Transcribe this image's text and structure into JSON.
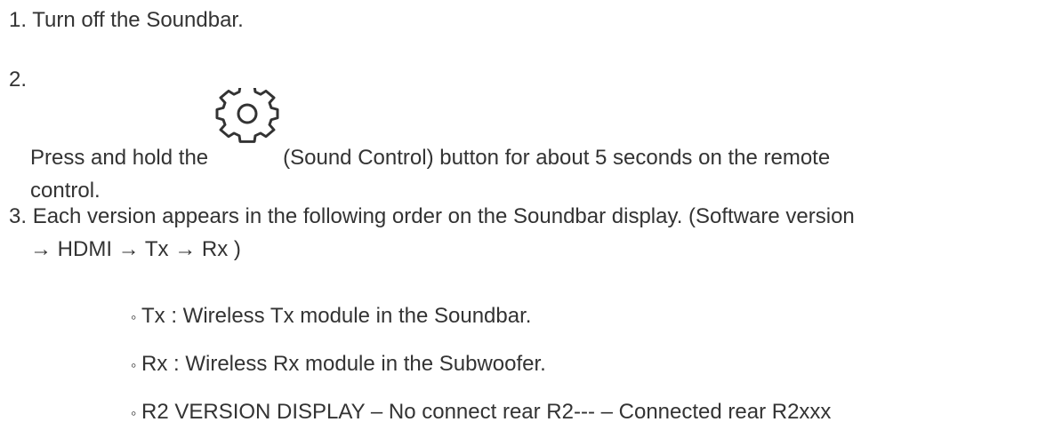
{
  "steps": [
    {
      "number": "1.",
      "text": "Turn off the Soundbar."
    },
    {
      "number": "2.",
      "text_before": "Press and hold the",
      "text_after": "(Sound Control) button for about 5 seconds on the remote",
      "text_line2": "control.",
      "icon": "gear-icon"
    },
    {
      "number": "3.",
      "text": "Each version appears in the following order on the Soundbar display. (Software version",
      "text_line2": "→ HDMI → Tx → Rx )"
    }
  ],
  "subitems": [
    {
      "bullet": "◦",
      "text": "Tx : Wireless Tx module in the Soundbar."
    },
    {
      "bullet": "◦",
      "text": "Rx : Wireless Rx module in the Subwoofer."
    },
    {
      "bullet": "◦",
      "text": "R2 VERSION DISPLAY – No connect rear R2--- – Connected rear R2xxx"
    }
  ],
  "colors": {
    "text": "#333333",
    "background": "#ffffff"
  }
}
